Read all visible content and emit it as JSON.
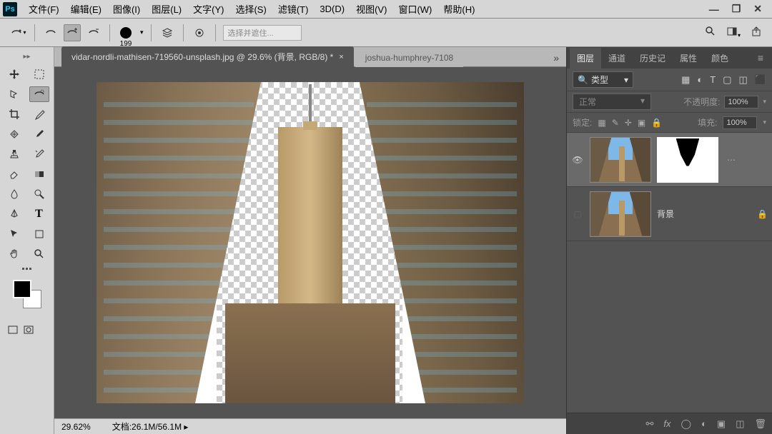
{
  "menu": {
    "items": [
      "文件(F)",
      "编辑(E)",
      "图像(I)",
      "图层(L)",
      "文字(Y)",
      "选择(S)",
      "滤镜(T)",
      "3D(D)",
      "视图(V)",
      "窗口(W)",
      "帮助(H)"
    ]
  },
  "optbar": {
    "brush_size": "199",
    "select_mask": "选择并遮住..."
  },
  "tabs": {
    "active": "vidar-nordli-mathisen-719560-unsplash.jpg @ 29.6% (背景, RGB/8) *",
    "inactive": "joshua-humphrey-7108"
  },
  "status": {
    "zoom": "29.62%",
    "doc_label": "文档:",
    "doc_size": "26.1M/56.1M"
  },
  "panels": {
    "tabs": [
      "图层",
      "通道",
      "历史记",
      "属性",
      "颜色"
    ],
    "filter_label": "类型",
    "blend_mode": "正常",
    "opacity_label": "不透明度:",
    "opacity_value": "100%",
    "lock_label": "锁定:",
    "fill_label": "填充:",
    "fill_value": "100%",
    "layers": [
      {
        "name": "",
        "has_mask": true,
        "visible": true,
        "selected": true
      },
      {
        "name": "背景",
        "has_mask": false,
        "visible": false,
        "locked": true
      }
    ]
  }
}
